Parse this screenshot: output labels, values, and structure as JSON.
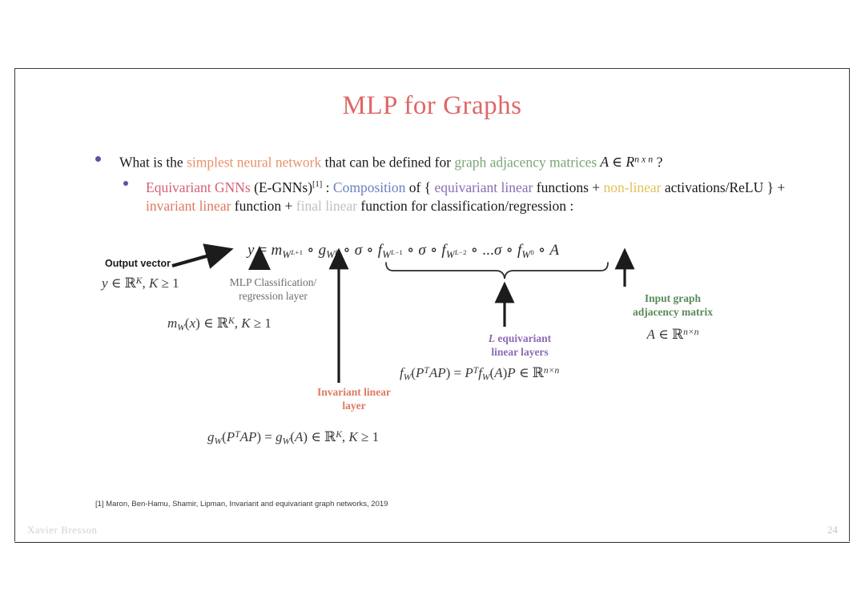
{
  "slide": {
    "title": "MLP for Graphs",
    "page_number": "24",
    "author": "Xavier Bresson",
    "footnote": "[1] Maron, Ben-Hamu, Shamir, Lipman, Invariant and equivariant graph networks, 2019"
  },
  "colors": {
    "title": "#e06666",
    "bullet_dot": "#5b54a4",
    "simplest_neural_network": "#e8926b",
    "graph_adjacency_matrices": "#7aa57a",
    "equivariant_gnns": "#d4607a",
    "composition": "#6a7fc0",
    "equivariant_linear": "#8a6bb5",
    "non_linear": "#e2c15a",
    "invariant_linear": "#dd7a5e",
    "final_linear": "#c0c0c0",
    "input_graph_label": "#5a8a5a",
    "mlp_layer_label": "#6d6d6d"
  },
  "bullets": {
    "level1": {
      "part1": "What is the ",
      "highlight1": "simplest neural network",
      "part2": " that can be defined for ",
      "highlight2": "graph adjacency matrices",
      "part3": " ?",
      "math": "A ∈ R",
      "math_sup": "n x n"
    },
    "level2": {
      "name": "Equivariant GNNs",
      "paren": " (E-GNNs)",
      "ref": "[1]",
      "colon": " : ",
      "composition": "Composition",
      "of_open": " of { ",
      "equivariant_linear": "equivariant linear",
      "functions_plus": " functions + ",
      "non_linear": "non-linear",
      "activations": "activations/ReLU } + ",
      "invariant_linear": "invariant linear",
      "function_plus": " function + ",
      "final_linear": "final linear",
      "tail": " function for classification/regression :"
    }
  },
  "equation_main": {
    "lhs": "y",
    "eq": "=",
    "terms": "m_{W^{L+1}} ∘ g_{W^L} ∘ σ ∘ f_{W^{L-1}} ∘ σ ∘ f_{W^{L-2}} ∘ ...σ ∘ f_{W^0} ∘ A"
  },
  "annotations": {
    "output_vector": {
      "label": "Output vector",
      "math": "y ∈ ℝ^K, K ≥ 1"
    },
    "mlp_layer": {
      "line1": "MLP Classification/",
      "line2": "regression layer",
      "math": "m_W(x) ∈ ℝ^K, K ≥ 1"
    },
    "invariant_layer": {
      "line1": "Invariant linear",
      "line2": "layer",
      "math": "g_W(P^T AP) = g_W(A) ∈ ℝ^K, K ≥ 1"
    },
    "equivariant_layers": {
      "line1_italic": "L",
      "line1_rest": " equivariant",
      "line2": "linear layers",
      "math": "f_W(P^T AP) = P^T f_W(A)P ∈ ℝ^{n×n}"
    },
    "input_graph": {
      "line1": "Input graph",
      "line2": "adjacency matrix",
      "math": "A ∈ ℝ^{n×n}"
    }
  }
}
